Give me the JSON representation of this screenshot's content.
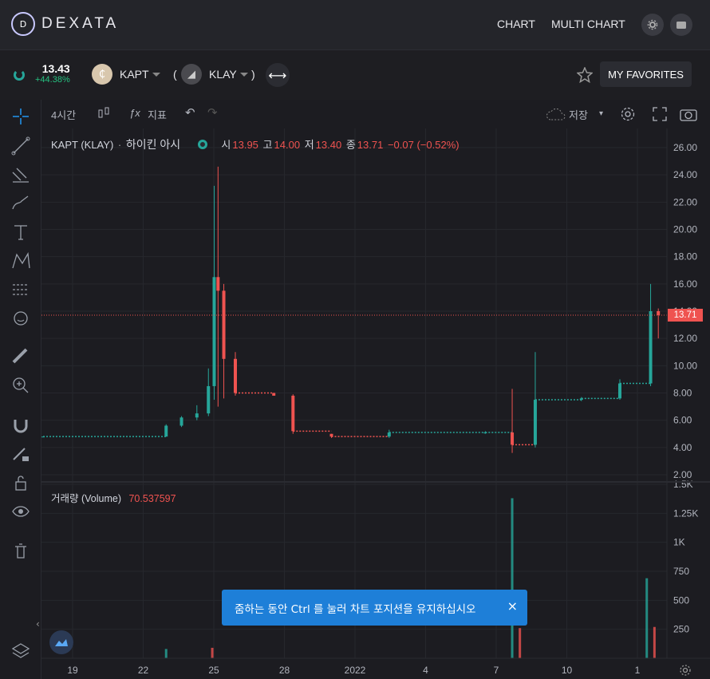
{
  "app": {
    "name": "DEXATA",
    "logo_mark": "D"
  },
  "nav": {
    "chart": "CHART",
    "multi_chart": "MULTI CHART",
    "settings_icon": "gear-icon",
    "wallet_icon": "wallet-icon"
  },
  "pair": {
    "price": "13.43",
    "change": "+44.38%",
    "base": "KAPT",
    "open_paren": "(",
    "quote": "KLAY",
    "close_paren": ")",
    "swap_icon": "swap-arrows-icon",
    "favorites_label": "MY FAVORITES"
  },
  "toolbar": {
    "interval": "4시간",
    "indicators": "지표",
    "save": "저장"
  },
  "legend": {
    "symbol": "KAPT (KLAY)",
    "chart_style": "하이킨 아시",
    "o_label": "시",
    "o": "13.95",
    "h_label": "고",
    "h": "14.00",
    "l_label": "저",
    "l": "13.40",
    "c_label": "종",
    "c": "13.71",
    "change": "−0.07 (−0.52%)"
  },
  "volume_legend": {
    "label": "거래량 (Volume)",
    "value": "70.537597"
  },
  "price_tag": "13.71",
  "toast": {
    "message": "줌하는 동안 Ctrl 를 눌러 차트 포지션을 유지하십시오",
    "close": "×"
  },
  "colors": {
    "up": "#26a69a",
    "down": "#ef5350",
    "accent": "#1e7fd8"
  },
  "chart_data": {
    "type": "bar",
    "price_axis": [
      "26.00",
      "24.00",
      "22.00",
      "20.00",
      "18.00",
      "16.00",
      "14.00",
      "12.00",
      "10.00",
      "8.00",
      "6.00",
      "4.00",
      "2.00"
    ],
    "volume_axis": [
      "1.5K",
      "1.25K",
      "1K",
      "750",
      "500",
      "250"
    ],
    "x_ticks": [
      "19",
      "22",
      "25",
      "28",
      "2022",
      "4",
      "7",
      "10",
      "1"
    ],
    "ylim": [
      2,
      26
    ],
    "volume_ylim": [
      0,
      1500
    ],
    "candles": [
      {
        "x": 0.0,
        "o": 4.8,
        "h": 4.8,
        "l": 4.8,
        "c": 4.8
      },
      {
        "x": 3.2,
        "o": 4.8,
        "h": 5.7,
        "l": 4.8,
        "c": 5.6
      },
      {
        "x": 3.6,
        "o": 5.6,
        "h": 6.3,
        "l": 5.5,
        "c": 6.2
      },
      {
        "x": 4.0,
        "o": 6.2,
        "h": 7.1,
        "l": 6.0,
        "c": 6.5
      },
      {
        "x": 4.3,
        "o": 6.5,
        "h": 9.8,
        "l": 6.3,
        "c": 8.5
      },
      {
        "x": 4.45,
        "o": 8.5,
        "h": 23.2,
        "l": 7.5,
        "c": 16.5
      },
      {
        "x": 4.55,
        "o": 16.5,
        "h": 24.6,
        "l": 7.0,
        "c": 15.5
      },
      {
        "x": 4.7,
        "o": 15.5,
        "h": 16.0,
        "l": 7.6,
        "c": 10.5
      },
      {
        "x": 5.0,
        "o": 10.5,
        "h": 11.0,
        "l": 7.8,
        "c": 8.0
      },
      {
        "x": 6.0,
        "o": 8.0,
        "h": 8.0,
        "l": 7.8,
        "c": 7.8
      },
      {
        "x": 6.5,
        "o": 7.8,
        "h": 7.9,
        "l": 5.0,
        "c": 5.2
      },
      {
        "x": 7.5,
        "o": 5.0,
        "h": 5.0,
        "l": 4.7,
        "c": 4.8
      },
      {
        "x": 9.0,
        "o": 4.8,
        "h": 5.3,
        "l": 4.7,
        "c": 5.1
      },
      {
        "x": 11.5,
        "o": 5.1,
        "h": 5.2,
        "l": 5.0,
        "c": 5.1
      },
      {
        "x": 12.2,
        "o": 5.1,
        "h": 8.3,
        "l": 3.6,
        "c": 4.2
      },
      {
        "x": 12.8,
        "o": 4.2,
        "h": 11.0,
        "l": 4.0,
        "c": 7.5
      },
      {
        "x": 14.0,
        "o": 7.5,
        "h": 7.7,
        "l": 7.4,
        "c": 7.6
      },
      {
        "x": 15.0,
        "o": 7.6,
        "h": 9.0,
        "l": 7.5,
        "c": 8.7
      },
      {
        "x": 15.8,
        "o": 8.7,
        "h": 16.0,
        "l": 8.5,
        "c": 14.0
      },
      {
        "x": 16.0,
        "o": 14.0,
        "h": 14.2,
        "l": 12.0,
        "c": 13.71
      }
    ],
    "volumes": [
      {
        "x": 3.2,
        "v": 80,
        "dir": "up"
      },
      {
        "x": 4.4,
        "v": 90,
        "dir": "down"
      },
      {
        "x": 12.2,
        "v": 1380,
        "dir": "up"
      },
      {
        "x": 12.4,
        "v": 260,
        "dir": "down"
      },
      {
        "x": 15.7,
        "v": 690,
        "dir": "up"
      },
      {
        "x": 15.9,
        "v": 270,
        "dir": "down"
      }
    ]
  }
}
